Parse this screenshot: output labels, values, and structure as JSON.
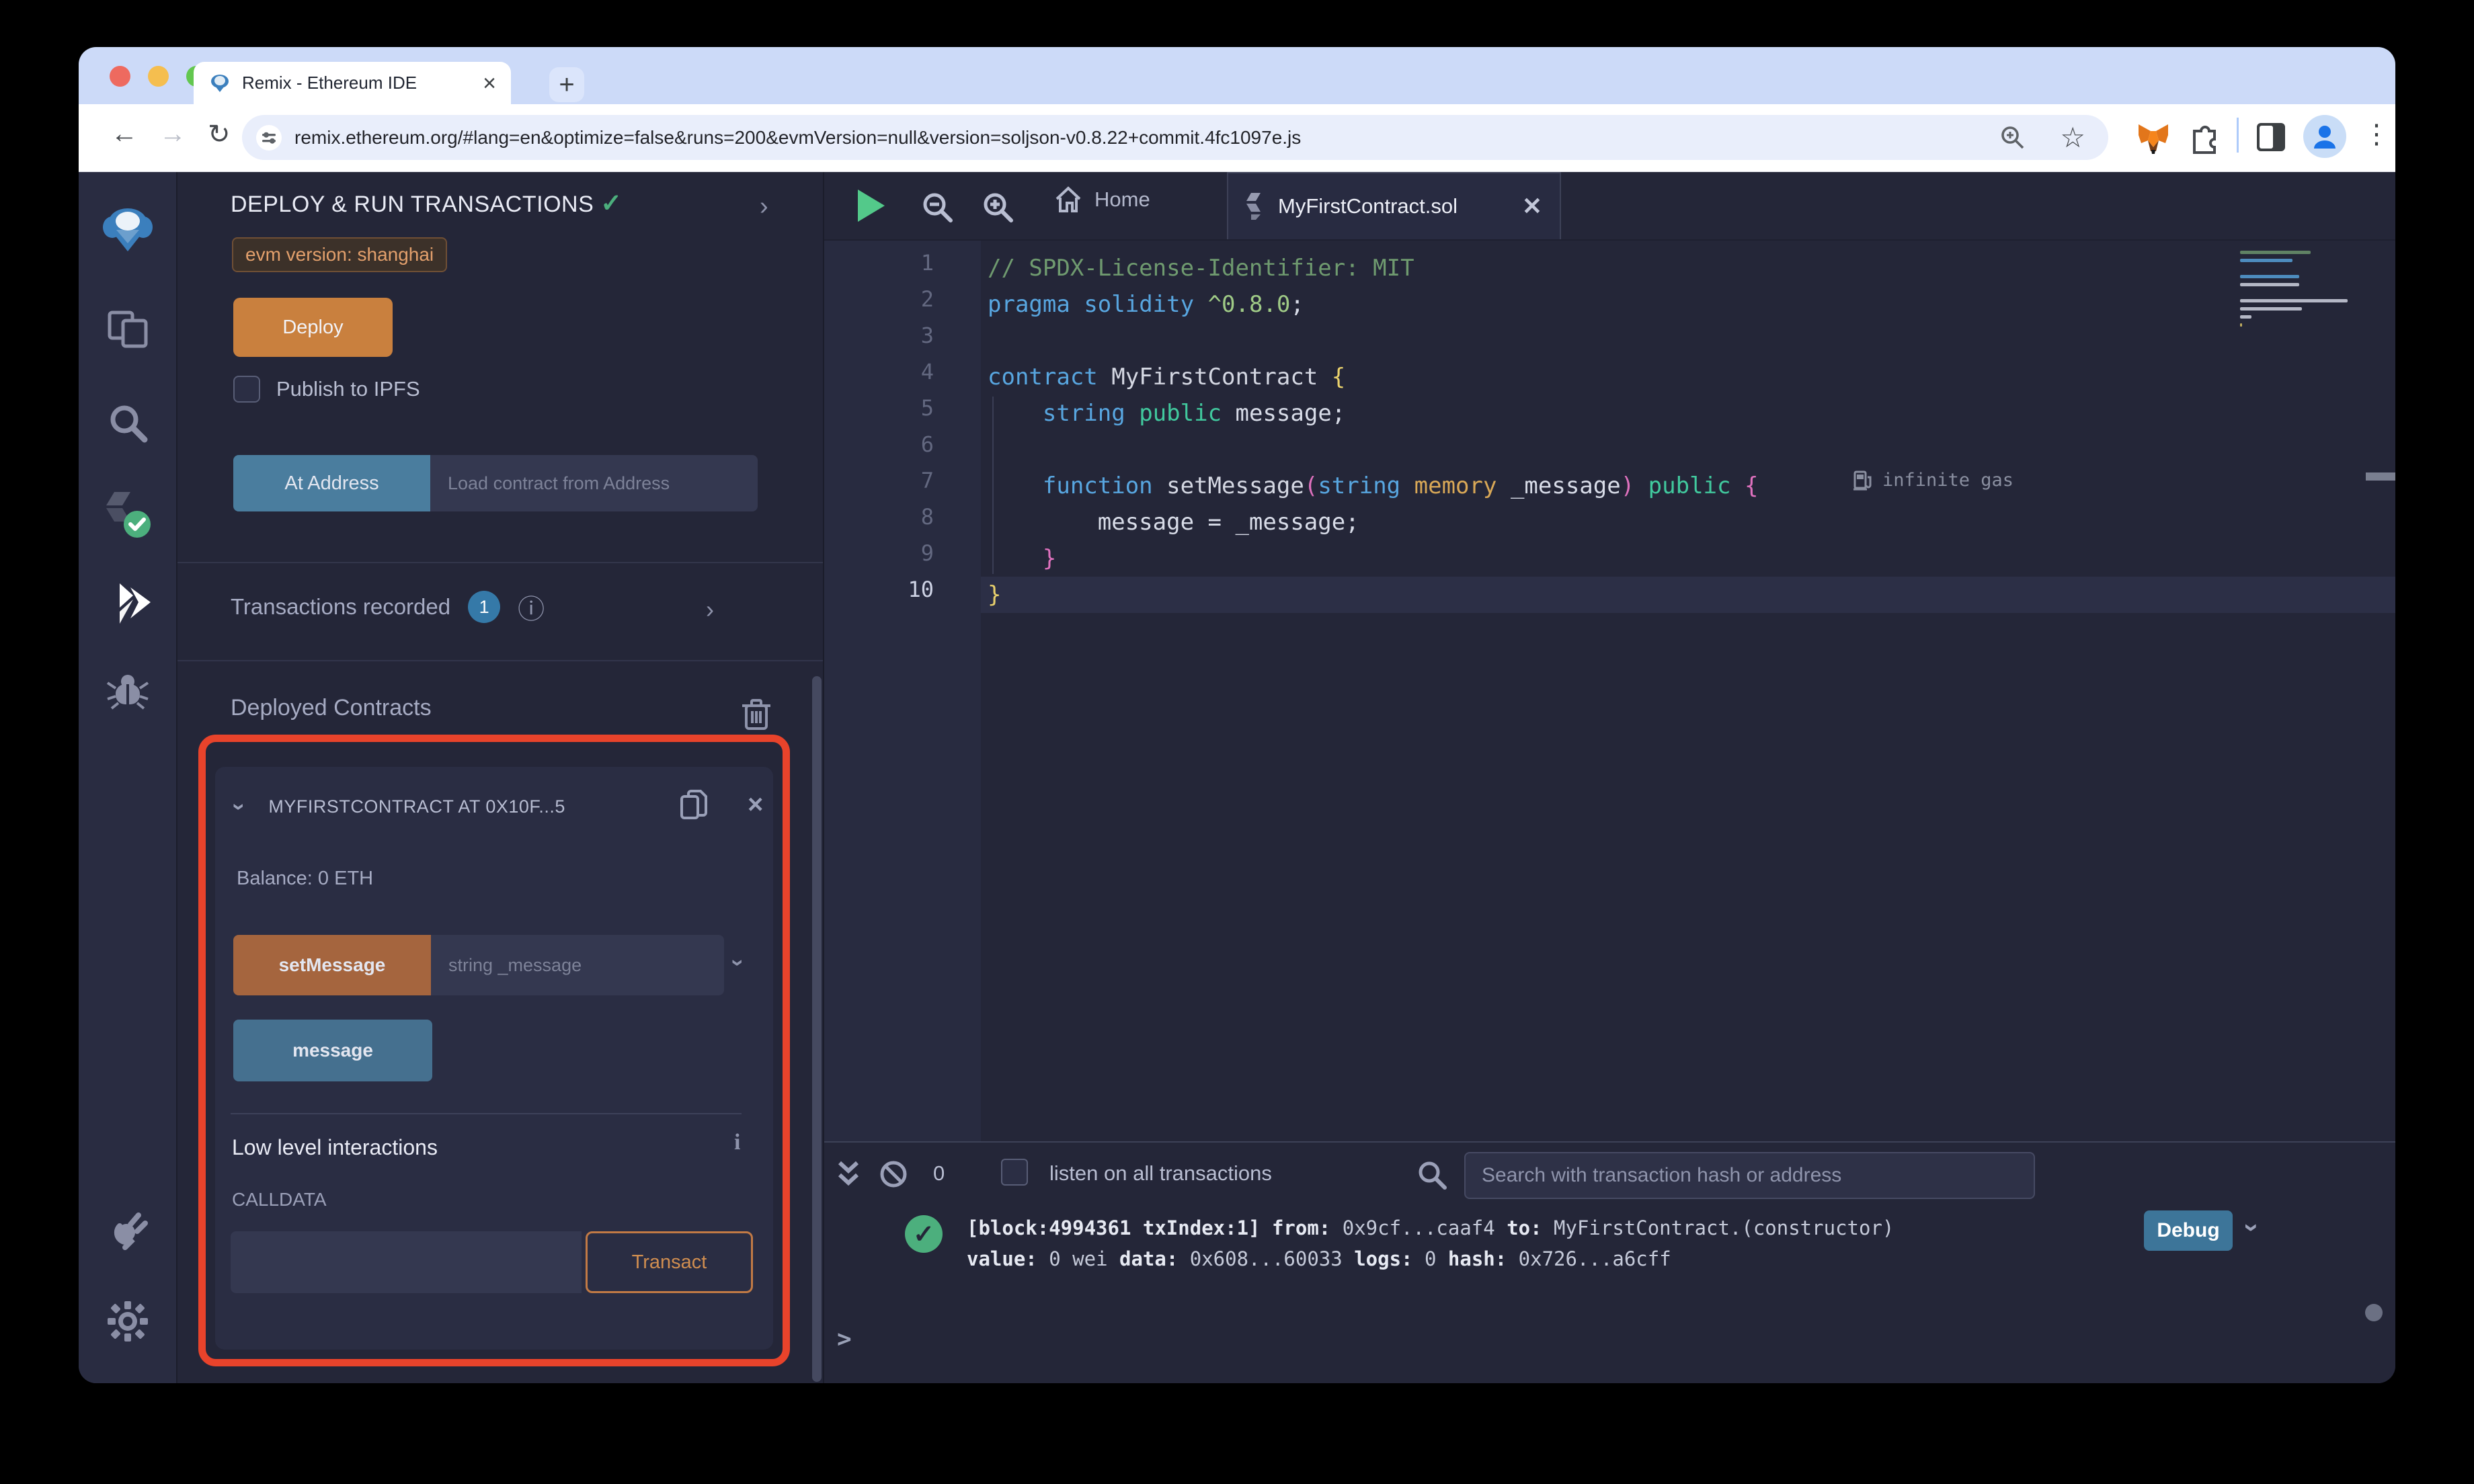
{
  "browser": {
    "tab_title": "Remix - Ethereum IDE",
    "url": "remix.ethereum.org/#lang=en&optimize=false&runs=200&evmVersion=null&version=soljson-v0.8.22+commit.4fc1097e.js",
    "glyphs": {
      "close": "×",
      "plus": "+",
      "back": "←",
      "forward": "→",
      "reload": "↻",
      "star": "☆",
      "kebab": "⋮"
    }
  },
  "panel": {
    "title": "DEPLOY & RUN TRANSACTIONS",
    "check": "✓",
    "chevron": "›",
    "evm_badge": "evm version: shanghai",
    "deploy_label": "Deploy",
    "publish_label": "Publish to IPFS",
    "at_address_label": "At Address",
    "at_address_placeholder": "Load contract from Address",
    "tx_recorded_label": "Transactions recorded",
    "tx_count": "1",
    "info_glyph": "ⓘ",
    "deployed_label": "Deployed Contracts",
    "contract": {
      "title": "MYFIRSTCONTRACT AT 0X10F...5",
      "close": "×",
      "balance": "Balance: 0 ETH",
      "set_message_label": "setMessage",
      "set_message_placeholder": "string _message",
      "message_label": "message",
      "low_level_label": "Low level interactions",
      "info_glyph": "i",
      "calldata_label": "CALLDATA",
      "transact_label": "Transact"
    }
  },
  "editor": {
    "home_tab": "Home",
    "file_tab": "MyFirstContract.sol",
    "tab_close": "✕",
    "gas_note": "infinite gas",
    "code": [
      {
        "n": "1",
        "t": [
          [
            "// SPDX-License-Identifier: MIT",
            "comment"
          ]
        ]
      },
      {
        "n": "2",
        "t": [
          [
            "pragma",
            "kw"
          ],
          [
            " ",
            "pl"
          ],
          [
            "solidity",
            "kw"
          ],
          [
            " ",
            "pl"
          ],
          [
            "^0.8.0",
            "ver"
          ],
          [
            ";",
            "pl"
          ]
        ]
      },
      {
        "n": "3",
        "t": []
      },
      {
        "n": "4",
        "t": [
          [
            "contract",
            "kw"
          ],
          [
            " ",
            "pl"
          ],
          [
            "MyFirstContract",
            "type"
          ],
          [
            " ",
            "pl"
          ],
          [
            "{",
            "b1"
          ]
        ]
      },
      {
        "n": "5",
        "t": [
          [
            "    ",
            "pl"
          ],
          [
            "string",
            "kw"
          ],
          [
            " ",
            "pl"
          ],
          [
            "public",
            "kwg"
          ],
          [
            " ",
            "pl"
          ],
          [
            "message",
            "pl"
          ],
          [
            ";",
            "pl"
          ]
        ]
      },
      {
        "n": "6",
        "t": []
      },
      {
        "n": "7",
        "t": [
          [
            "    ",
            "pl"
          ],
          [
            "function",
            "kw"
          ],
          [
            " ",
            "pl"
          ],
          [
            "setMessage",
            "fn"
          ],
          [
            "(",
            "b2"
          ],
          [
            "string",
            "kw"
          ],
          [
            " ",
            "pl"
          ],
          [
            "memory",
            "kwy"
          ],
          [
            " _message",
            "pl"
          ],
          [
            ")",
            "b2"
          ],
          [
            " ",
            "pl"
          ],
          [
            "public",
            "kwg"
          ],
          [
            " ",
            "pl"
          ],
          [
            "{",
            "b2"
          ]
        ]
      },
      {
        "n": "8",
        "t": [
          [
            "        message = _message;",
            "pl"
          ]
        ]
      },
      {
        "n": "9",
        "t": [
          [
            "    ",
            "pl"
          ],
          [
            "}",
            "b2"
          ]
        ]
      },
      {
        "n": "10",
        "t": [
          [
            "}",
            "b1"
          ]
        ],
        "active": true
      }
    ]
  },
  "terminal": {
    "count": "0",
    "listen_label": "listen on all transactions",
    "search_placeholder": "Search with transaction hash or address",
    "check": "✓",
    "log_line1": [
      [
        "[block:4994361 txIndex:1]",
        "b"
      ],
      [
        "  ",
        "r"
      ],
      [
        "from:",
        "b"
      ],
      [
        " 0x9cf...caaf4 ",
        "r"
      ],
      [
        "to:",
        "b"
      ],
      [
        " MyFirstContract.(constructor)",
        "r"
      ]
    ],
    "log_line2": [
      [
        "value:",
        "b"
      ],
      [
        " 0 wei ",
        "r"
      ],
      [
        "data:",
        "b"
      ],
      [
        " 0x608...60033 ",
        "r"
      ],
      [
        "logs:",
        "b"
      ],
      [
        " 0 ",
        "r"
      ],
      [
        "hash:",
        "b"
      ],
      [
        " 0x726...a6cff",
        "r"
      ]
    ],
    "debug_label": "Debug",
    "prompt": ">"
  }
}
